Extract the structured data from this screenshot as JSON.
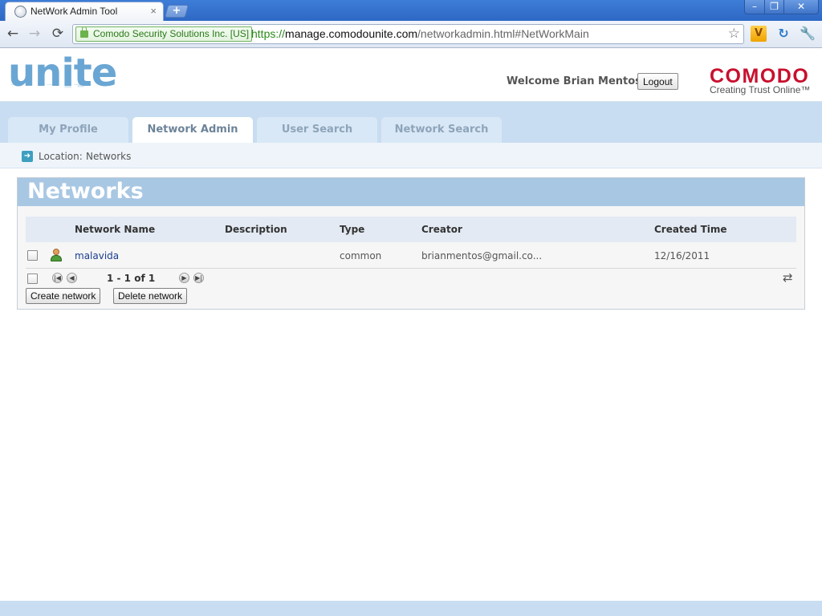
{
  "browser": {
    "tab_title": "NetWork Admin Tool",
    "tab_close": "×",
    "new_tab": "+",
    "window_controls": {
      "minimize": "–",
      "maximize": "❐",
      "close": "✕"
    },
    "nav": {
      "back": "←",
      "forward": "→",
      "reload": "⟳"
    },
    "ev_badge": "Comodo Security Solutions Inc. [US]",
    "url": {
      "scheme": "https://",
      "host": "manage.comodounite.com",
      "path": "/networkadmin.html#NetWorkMain"
    },
    "star": "☆",
    "extensions": {
      "ext1": "V",
      "ext2": "↻",
      "wrench": "🔧"
    }
  },
  "header": {
    "logo": "unite",
    "welcome": "Welcome Brian Mentos",
    "logout_label": "Logout",
    "brand": "COMODO",
    "tagline": "Creating Trust Online™"
  },
  "tabs": [
    {
      "label": "My Profile",
      "active": false
    },
    {
      "label": "Network Admin",
      "active": true
    },
    {
      "label": "User Search",
      "active": false
    },
    {
      "label": "Network Search",
      "active": false
    }
  ],
  "location": {
    "label": "Location:",
    "value": "Networks"
  },
  "panel": {
    "title": "Networks",
    "columns": [
      "Network Name",
      "Description",
      "Type",
      "Creator",
      "Created Time"
    ],
    "rows": [
      {
        "name": "malavida",
        "description": "",
        "type": "common",
        "creator": "brianmentos@gmail.co...",
        "created": "12/16/2011"
      }
    ],
    "pager": {
      "text": "1 - 1 of 1",
      "first": "|◀",
      "prev": "◀",
      "next": "▶",
      "last": "▶|",
      "refresh": "⇄"
    },
    "buttons": {
      "create": "Create network",
      "delete": "Delete network"
    }
  },
  "colors": {
    "accent": "#a8c7e3",
    "tab_band": "#c8ddf1",
    "brand_red": "#c8102e",
    "link": "#1a3d8f"
  }
}
